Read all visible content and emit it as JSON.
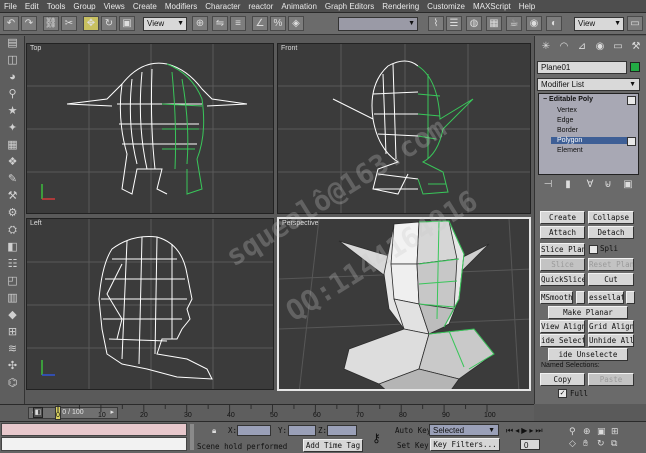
{
  "menu": [
    "File",
    "Edit",
    "Tools",
    "Group",
    "Views",
    "Create",
    "Modifiers",
    "Character",
    "reactor",
    "Animation",
    "Graph Editors",
    "Rendering",
    "Customize",
    "MAXScript",
    "Help"
  ],
  "toolbar": {
    "view_dropdown_1": "View",
    "view_dropdown_2": "View"
  },
  "viewports": {
    "top": "Top",
    "front": "Front",
    "left": "Left",
    "perspective": "Perspective"
  },
  "command_panel": {
    "object_name": "Plane01",
    "object_color": "#22aa44",
    "modifier_list": "Modifier List",
    "stack": {
      "root": "Editable Poly",
      "items": [
        "Vertex",
        "Edge",
        "Border",
        "Polygon",
        "Element"
      ],
      "selected": "Polygon"
    },
    "buttons": {
      "create": "Create",
      "collapse": "Collapse",
      "attach": "Attach",
      "detach": "Detach",
      "slice_plane": "Slice Plane",
      "split": "Spli",
      "slice": "Slice",
      "reset_plane": "Reset Plane",
      "quickslice": "QuickSlice",
      "cut": "Cut",
      "msmooth": "MSmooth",
      "tessellate": "essellat",
      "make_planar": "Make Planar",
      "view_align": "View Align",
      "grid_align": "Grid Align",
      "hide_selected": "ide Selecte",
      "unhide_all": "Unhide All",
      "hide_unselected": "ide Unselecte",
      "copy": "Copy",
      "paste": "Paste"
    },
    "named_selections_label": "Named Selections:",
    "full_label": "Full",
    "full_checked": "✓"
  },
  "timeline": {
    "frame_counter": "0 / 100",
    "ticks": [
      "0",
      "10",
      "20",
      "30",
      "40",
      "50",
      "60",
      "70",
      "80",
      "90",
      "100"
    ]
  },
  "status": {
    "prompt": "Scene hold performed",
    "add_time_tag": "Add Time Tag",
    "x_label": "X:",
    "y_label": "Y:",
    "z_label": "Z:",
    "auto_key": "Auto Key",
    "set_key": "Set Key",
    "selected_dropdown": "Selected",
    "key_filters": "Key Filters...",
    "frame_value": "0"
  },
  "watermark": {
    "line1": "squealô@163.com",
    "line2": "QQ:1144164916"
  }
}
